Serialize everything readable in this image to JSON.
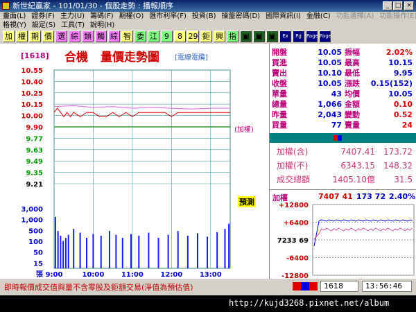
{
  "window": {
    "title": "新世紀贏家 - 101/01/30 - 個股走勢 : 播報順序"
  },
  "menu": {
    "row1": [
      "畫面(L)",
      "證券(F)",
      "主力(U)",
      "籌碼(F)",
      "期權(O)",
      "匯市利率(F)",
      "投資(B)",
      "操盤密碼(D)",
      "國際資訊(I)",
      "金融(C)",
      "功能選擇(A)",
      "功能操作(E)"
    ],
    "row2": [
      "格視(Y)",
      "設定(S)",
      "工具(T)",
      "說明(H)"
    ]
  },
  "toolbar": [
    "加",
    "權",
    "期",
    "價",
    "選",
    "綜",
    "類",
    "觸",
    "綜",
    "智",
    "委",
    "江",
    "9",
    "8",
    "29",
    "鉅",
    "興",
    "指",
    "▣",
    "▣",
    "▣",
    "Ex",
    "Pg",
    "Page",
    "Page"
  ],
  "chart_header": {
    "code": "[1618]",
    "name": "合機",
    "title": "量價走勢圖",
    "sector": "[電線電纜]"
  },
  "chart_data": {
    "type": "line",
    "x_ticks": [
      "9:00",
      "10:00",
      "11:00",
      "12:00",
      "13:00"
    ],
    "y_price_ticks": [
      "10.55",
      "10.40",
      "10.25",
      "10.15",
      "10.00",
      "9.90",
      "9.77",
      "9.63",
      "9.49",
      "9.35",
      "9.21"
    ],
    "price_range": [
      9.21,
      10.55
    ],
    "reference_price": 9.9,
    "reference_label": "(加權)",
    "series": [
      {
        "name": "price",
        "color": "#d00000",
        "x": [
          0,
          5,
          10,
          15,
          20,
          25,
          30,
          40,
          50,
          60,
          70,
          80,
          90,
          100,
          110,
          120,
          130,
          140,
          150,
          160,
          170,
          180,
          190,
          200,
          210,
          220,
          230,
          240,
          250,
          260,
          270
        ],
        "values": [
          10.05,
          10.1,
          10.05,
          10.0,
          10.05,
          10.0,
          10.05,
          10.0,
          10.05,
          10.05,
          10.0,
          10.0,
          10.05,
          10.0,
          10.05,
          10.0,
          10.05,
          10.05,
          10.05,
          10.05,
          10.05,
          10.0,
          10.05,
          10.05,
          10.05,
          10.05,
          10.05,
          10.05,
          10.05,
          10.05,
          10.05
        ]
      },
      {
        "name": "avg",
        "color": "#e060e0",
        "x": [
          0,
          30,
          60,
          90,
          120,
          150,
          180,
          210,
          240,
          270
        ],
        "values": [
          10.12,
          10.13,
          10.11,
          10.12,
          10.1,
          10.11,
          10.1,
          10.09,
          10.1,
          10.1
        ]
      }
    ],
    "y_volume_ticks": [
      "3,000",
      "1,000",
      "500",
      "100",
      "50",
      "15",
      "張"
    ],
    "volume_scale_max": 3000,
    "volume_x": [
      2,
      6,
      10,
      14,
      18,
      22,
      30,
      40,
      50,
      60,
      72,
      85,
      95,
      105,
      118,
      130,
      145,
      160,
      175,
      190,
      205,
      220,
      235,
      250,
      262,
      268
    ],
    "volume_values": [
      1000,
      150,
      80,
      40,
      60,
      90,
      200,
      120,
      60,
      100,
      80,
      150,
      90,
      60,
      100,
      80,
      120,
      60,
      90,
      150,
      80,
      110,
      70,
      130,
      200,
      400
    ],
    "annotation": "預測"
  },
  "quote": [
    {
      "a": "開盤",
      "b": "10.05",
      "c": "振幅",
      "d": "2.02%",
      "dred": true
    },
    {
      "a": "買進",
      "b": "10.05",
      "c": "最高",
      "d": "10.15"
    },
    {
      "a": "賣出",
      "b": "10.10",
      "c": "最低",
      "d": "9.95"
    },
    {
      "a": "收盤",
      "b": "10.05",
      "c": "漲跌",
      "d": "0.15(152)"
    },
    {
      "a": "單量",
      "b": "43",
      "c": "均價",
      "d": "10.05"
    },
    {
      "a": "總量",
      "b": "1,066",
      "c": "金額",
      "d": "0.10",
      "dred": true
    },
    {
      "a": "昨量",
      "b": "2,043",
      "c": "變動",
      "d": "0.52",
      "dred": true
    },
    {
      "a": "買量",
      "b": "77",
      "c": "賣量",
      "d": "24",
      "dred": true
    }
  ],
  "index": [
    {
      "label": "加權(含)",
      "value": "7407.41",
      "change": "173.72"
    },
    {
      "label": "加權(不)",
      "value": "6343.15",
      "change": "148.32"
    },
    {
      "label": "成交總額",
      "value": "1405.10億",
      "change": "31.5"
    }
  ],
  "mini": {
    "label": "加權",
    "value": "7407 41",
    "change": "173 72",
    "pct": "2.40%",
    "y_ticks": [
      "+12800",
      "+6400",
      "7233 69",
      "-6400",
      "-12800"
    ]
  },
  "footer": {
    "note": "即時報價成交值與量不含零股及鉅額交易(淨值為預估值)",
    "code": "1618",
    "time": "13:56:46"
  },
  "bottom": {
    "url": "http://kujd3268.pixnet.net/album"
  },
  "colors": {
    "accent": "#c0007a",
    "price": "#d00000",
    "avg": "#e060e0",
    "volume": "#1a1aff",
    "grid": "#40a0a0",
    "index": "#c8387a"
  }
}
